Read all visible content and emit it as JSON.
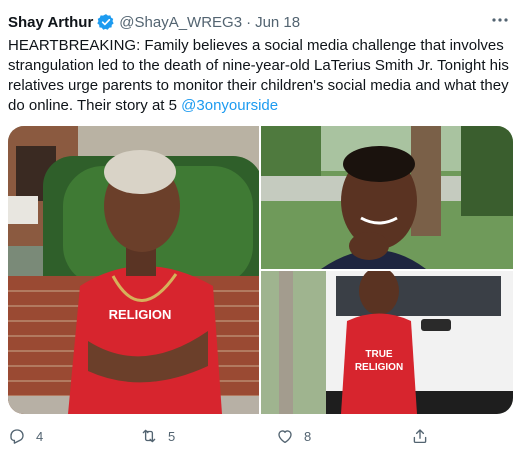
{
  "tweet": {
    "author_name": "Shay Arthur",
    "handle": "@ShayA_WREG3",
    "separator": "·",
    "date": "Jun 18",
    "text_main": "HEARTBREAKING: Family believes a social media challenge that involves strangulation led to the death of nine-year-old LaTerius Smith Jr. Tonight his relatives urge parents to monitor their children's social media and what they do online. Their story at 5 ",
    "mention": "@3onyourside",
    "shirt_text_1": "TRUE",
    "shirt_text_2": "RELIGION"
  },
  "actions": {
    "reply_count": "4",
    "retweet_count": "5",
    "like_count": "8"
  },
  "colors": {
    "verified_blue": "#1d9bf0",
    "link_blue": "#1d9bf0",
    "muted_text": "#536471",
    "shirt_red": "#d7252e"
  },
  "icons": [
    "verified-badge-icon",
    "more-options-icon",
    "reply-icon",
    "retweet-icon",
    "like-icon",
    "share-icon"
  ]
}
